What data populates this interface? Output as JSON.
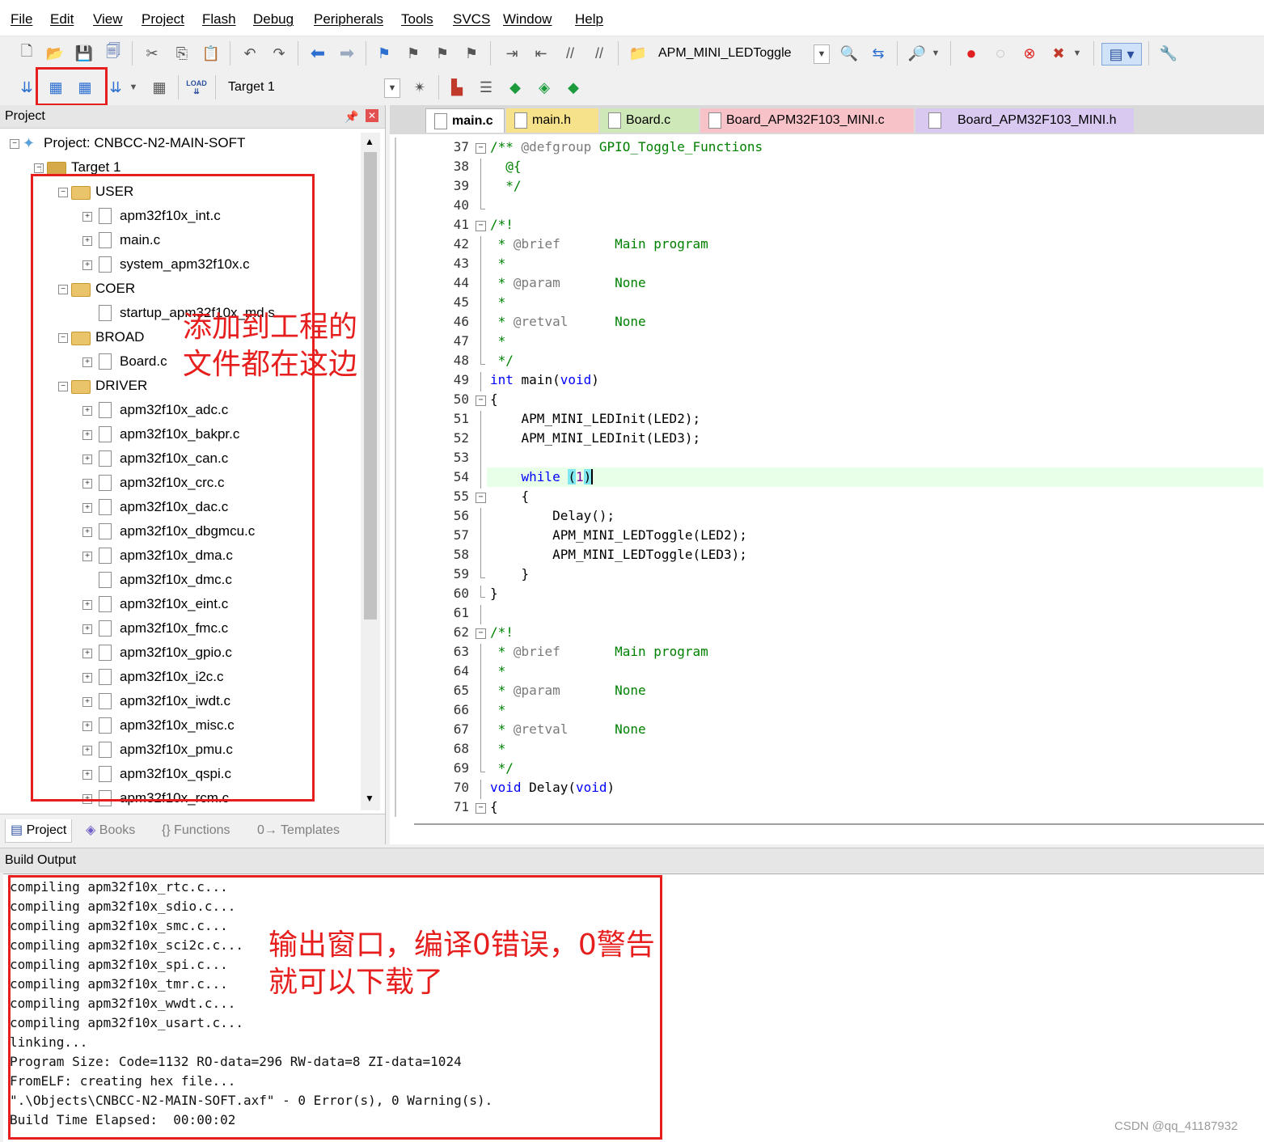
{
  "menu": [
    "File",
    "Edit",
    "View",
    "Project",
    "Flash",
    "Debug",
    "Peripherals",
    "Tools",
    "SVCS",
    "Window",
    "Help"
  ],
  "toolbar": {
    "target_combo": "APM_MINI_LEDToggle",
    "build_target": "Target 1",
    "load_label": "LOAD"
  },
  "project_panel": {
    "title": "Project",
    "pin": "ᵖ",
    "root": "Project: CNBCC-N2-MAIN-SOFT",
    "target": "Target 1",
    "groups": [
      {
        "name": "USER",
        "files": [
          "apm32f10x_int.c",
          "main.c",
          "system_apm32f10x.c"
        ]
      },
      {
        "name": "COER",
        "files": [
          "startup_apm32f10x_md.s"
        ]
      },
      {
        "name": "BROAD",
        "files": [
          "Board.c"
        ]
      },
      {
        "name": "DRIVER",
        "files": [
          "apm32f10x_adc.c",
          "apm32f10x_bakpr.c",
          "apm32f10x_can.c",
          "apm32f10x_crc.c",
          "apm32f10x_dac.c",
          "apm32f10x_dbgmcu.c",
          "apm32f10x_dma.c",
          "apm32f10x_dmc.c",
          "apm32f10x_eint.c",
          "apm32f10x_fmc.c",
          "apm32f10x_gpio.c",
          "apm32f10x_i2c.c",
          "apm32f10x_iwdt.c",
          "apm32f10x_misc.c",
          "apm32f10x_pmu.c",
          "apm32f10x_qspi.c",
          "apm32f10x_rcm.c"
        ]
      }
    ],
    "tabs": [
      "Project",
      "Books",
      "{} Functions",
      "0→ Templates"
    ]
  },
  "editor": {
    "tabs": [
      "main.c",
      "main.h",
      "Board.c",
      "Board_APM32F103_MINI.c",
      "Board_APM32F103_MINI.h"
    ],
    "lines": [
      {
        "n": "37",
        "t": "/** @defgroup GPIO_Toggle_Functions"
      },
      {
        "n": "38",
        "t": "  @{"
      },
      {
        "n": "39",
        "t": "  */"
      },
      {
        "n": "40",
        "t": ""
      },
      {
        "n": "41",
        "t": "/*!"
      },
      {
        "n": "42",
        "t": " * @brief       Main program"
      },
      {
        "n": "43",
        "t": " *"
      },
      {
        "n": "44",
        "t": " * @param       None"
      },
      {
        "n": "45",
        "t": " *"
      },
      {
        "n": "46",
        "t": " * @retval      None"
      },
      {
        "n": "47",
        "t": " *"
      },
      {
        "n": "48",
        "t": " */"
      },
      {
        "n": "49",
        "t": "int main(void)"
      },
      {
        "n": "50",
        "t": "{"
      },
      {
        "n": "51",
        "t": "    APM_MINI_LEDInit(LED2);"
      },
      {
        "n": "52",
        "t": "    APM_MINI_LEDInit(LED3);"
      },
      {
        "n": "53",
        "t": ""
      },
      {
        "n": "54",
        "t": "    while (1)"
      },
      {
        "n": "55",
        "t": "    {"
      },
      {
        "n": "56",
        "t": "        Delay();"
      },
      {
        "n": "57",
        "t": "        APM_MINI_LEDToggle(LED2);"
      },
      {
        "n": "58",
        "t": "        APM_MINI_LEDToggle(LED3);"
      },
      {
        "n": "59",
        "t": "    }"
      },
      {
        "n": "60",
        "t": "}"
      },
      {
        "n": "61",
        "t": ""
      },
      {
        "n": "62",
        "t": "/*!"
      },
      {
        "n": "63",
        "t": " * @brief       Main program"
      },
      {
        "n": "64",
        "t": " *"
      },
      {
        "n": "65",
        "t": " * @param       None"
      },
      {
        "n": "66",
        "t": " *"
      },
      {
        "n": "67",
        "t": " * @retval      None"
      },
      {
        "n": "68",
        "t": " *"
      },
      {
        "n": "69",
        "t": " */"
      },
      {
        "n": "70",
        "t": "void Delay(void)"
      },
      {
        "n": "71",
        "t": "{"
      }
    ]
  },
  "build_output": {
    "title": "Build Output",
    "lines": [
      "compiling apm32f10x_rtc.c...",
      "compiling apm32f10x_sdio.c...",
      "compiling apm32f10x_smc.c...",
      "compiling apm32f10x_sci2c.c...",
      "compiling apm32f10x_spi.c...",
      "compiling apm32f10x_tmr.c...",
      "compiling apm32f10x_wwdt.c...",
      "compiling apm32f10x_usart.c...",
      "linking...",
      "Program Size: Code=1132 RO-data=296 RW-data=8 ZI-data=1024",
      "FromELF: creating hex file...",
      "\".\\Objects\\CNBCC-N2-MAIN-SOFT.axf\" - 0 Error(s), 0 Warning(s).",
      "Build Time Elapsed:  00:00:02"
    ]
  },
  "annotations": {
    "project_note_1": "添加到工程的",
    "project_note_2": "文件都在这边",
    "output_note_1": "输出窗口，编译0错误，0警告",
    "output_note_2": "就可以下载了"
  },
  "watermark": "CSDN @qq_41187932",
  "colors": {
    "annotation": "#e61e1e",
    "keyword": "#0000ff",
    "comment": "#008000",
    "current_line": "#e8ffe8"
  }
}
